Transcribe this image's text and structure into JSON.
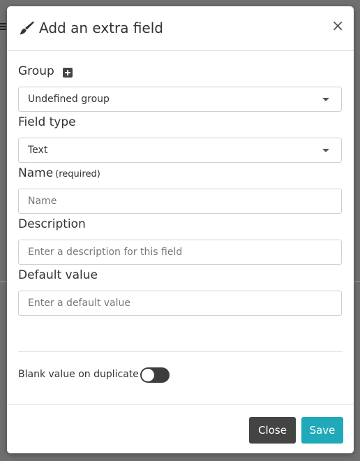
{
  "dialog": {
    "title": "Add an extra field",
    "close_symbol": "×",
    "title_icon": "brush-icon"
  },
  "form": {
    "group": {
      "label": "Group",
      "add_icon": "plus-square-icon",
      "selected": "Undefined group"
    },
    "field_type": {
      "label": "Field type",
      "selected": "Text"
    },
    "name": {
      "label": "Name",
      "hint": "(required)",
      "placeholder": "Name",
      "value": ""
    },
    "description": {
      "label": "Description",
      "placeholder": "Enter a description for this field",
      "value": ""
    },
    "default_value": {
      "label": "Default value",
      "placeholder": "Enter a default value",
      "value": ""
    },
    "blank_on_duplicate": {
      "label": "Blank value on duplicate",
      "enabled": false
    }
  },
  "footer": {
    "close_label": "Close",
    "save_label": "Save"
  },
  "colors": {
    "save_button": "#20aab9",
    "close_button": "#444444",
    "toggle_track": "#3d3d3d",
    "overlay": "#6f6f6f"
  }
}
